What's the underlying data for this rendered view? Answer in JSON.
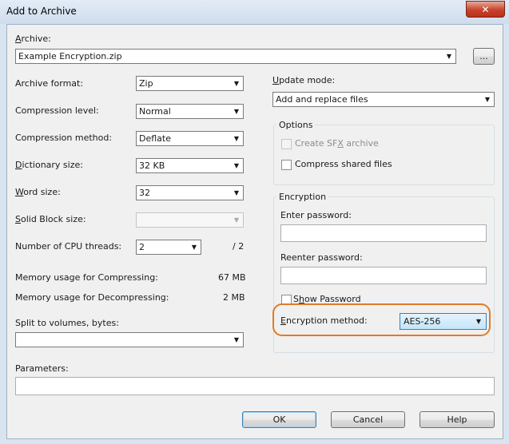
{
  "window": {
    "title": "Add to Archive",
    "close_glyph": "✕"
  },
  "archive": {
    "label_key": "A",
    "label_rest": "rchive:",
    "path": "Example Encryption.zip",
    "browse_label": "..."
  },
  "left": {
    "format": {
      "label": "Archive format:",
      "value": "Zip"
    },
    "level": {
      "label": "Compression level:",
      "value": "Normal"
    },
    "method": {
      "label": "Compression method:",
      "value": "Deflate"
    },
    "dict": {
      "label_key": "D",
      "label_rest": "ictionary size:",
      "value": "32 KB"
    },
    "word": {
      "label_key": "W",
      "label_rest": "ord size:",
      "value": "32"
    },
    "solid": {
      "label_key": "S",
      "label_rest": "olid Block size:",
      "value": ""
    },
    "cpu": {
      "label": "Number of CPU threads:",
      "value": "2",
      "total": "/ 2"
    },
    "mem_compress": {
      "label": "Memory usage for Compressing:",
      "value": "67 MB"
    },
    "mem_decompress": {
      "label": "Memory usage for Decompressing:",
      "value": "2 MB"
    },
    "split": {
      "label": "Split to volumes, bytes:",
      "value": ""
    }
  },
  "right": {
    "update": {
      "label_key": "U",
      "label_rest": "pdate mode:",
      "value": "Add and replace files"
    },
    "options": {
      "title": "Options",
      "sfx_pre": "Create SF",
      "sfx_key": "X",
      "sfx_post": " archive",
      "shared_label": "Compress shared files"
    },
    "encryption": {
      "title": "Encryption",
      "enter_label": "Enter password:",
      "reenter_label": "Reenter password:",
      "show_pre": "S",
      "show_key": "h",
      "show_post": "ow Password",
      "method_key": "E",
      "method_rest": "ncryption method:",
      "method_value": "AES-256"
    }
  },
  "parameters": {
    "label": "Parameters:",
    "value": ""
  },
  "buttons": {
    "ok": "OK",
    "cancel": "Cancel",
    "help": "Help"
  },
  "colors": {
    "highlight": "#e07b28",
    "default_button": "#3c7fb1"
  }
}
